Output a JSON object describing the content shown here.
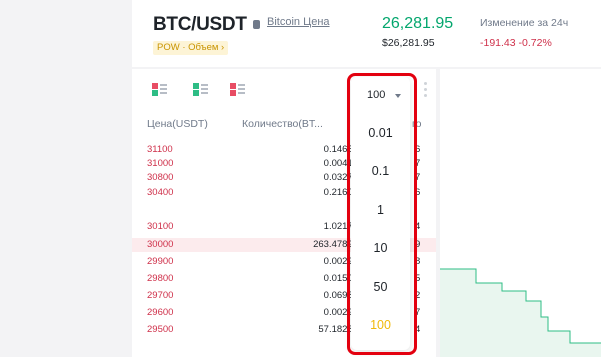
{
  "header": {
    "pair": "BTC/USDT",
    "bitcoin_link": "Bitcoin Цена",
    "tag": "POW · Объем ›",
    "price": "26,281.95",
    "price_usd": "$26,281.95",
    "change_label": "Изменение за 24ч",
    "change_value": "-191.43 -0.72%"
  },
  "colors": {
    "ask_red": "#cf304a",
    "bid_green": "#03a66d",
    "accent_yellow": "#f0b90b",
    "highlight_red": "#e3000f"
  },
  "orderbook": {
    "precision": "100",
    "columns": {
      "price": "Цена(USDT)",
      "amount": "Количество(BT...",
      "total": "го"
    },
    "rows": [
      {
        "price": "31100",
        "amount": "0.14652",
        "total_tail": "6"
      },
      {
        "price": "31000",
        "amount": "0.00412",
        "total_tail": "7"
      },
      {
        "price": "30800",
        "amount": "0.03271",
        "total_tail": "7"
      },
      {
        "price": "30400",
        "amount": "0.21608",
        "total_tail": "6"
      },
      {
        "price": "30100",
        "amount": "1.02178",
        "total_tail": "4"
      },
      {
        "price": "30000",
        "amount": "263.47896",
        "total_tail": "9"
      },
      {
        "price": "29900",
        "amount": "0.00294",
        "total_tail": "8"
      },
      {
        "price": "29800",
        "amount": "0.01500",
        "total_tail": "5"
      },
      {
        "price": "29700",
        "amount": "0.06981",
        "total_tail": "2"
      },
      {
        "price": "29600",
        "amount": "0.00294",
        "total_tail": "7"
      },
      {
        "price": "29500",
        "amount": "57.18285",
        "total_tail": "4"
      }
    ]
  },
  "precision_menu": {
    "selected": "100",
    "options": [
      "0.01",
      "0.1",
      "1",
      "10",
      "50",
      "100"
    ]
  }
}
